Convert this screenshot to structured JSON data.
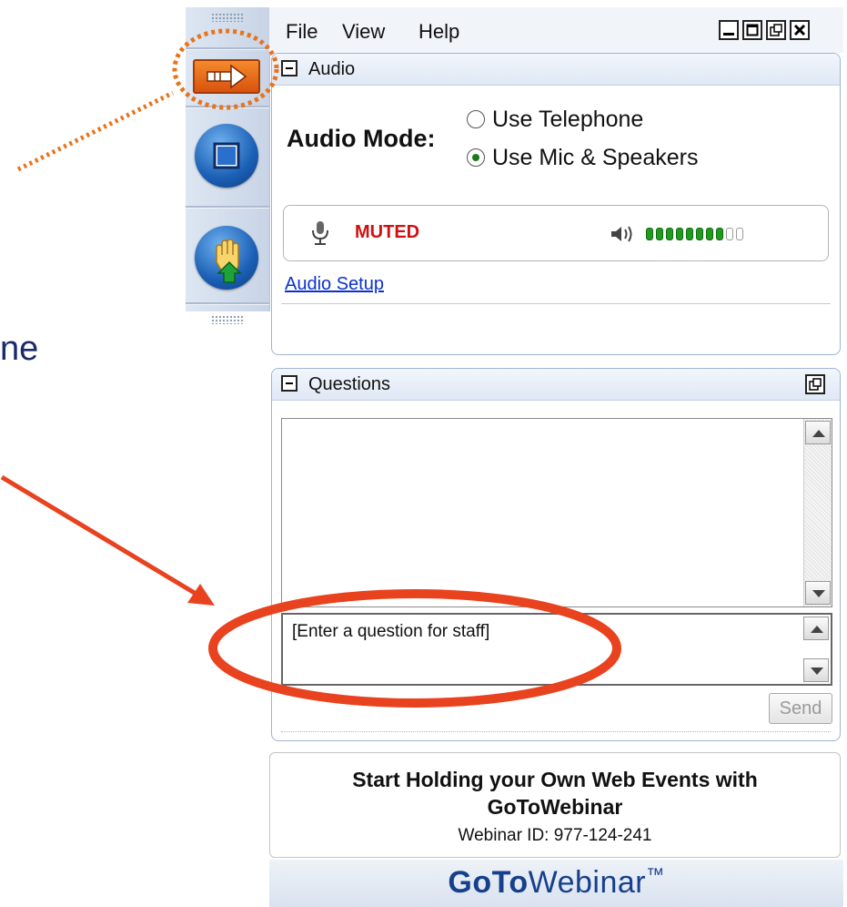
{
  "slide": {
    "text_fragment": "ne"
  },
  "menubar": {
    "file": "File",
    "view": "View",
    "help": "Help"
  },
  "audio": {
    "header": "Audio",
    "mode_label": "Audio Mode:",
    "options": [
      "Use Telephone",
      "Use Mic & Speakers"
    ],
    "selected_option": "Use Mic & Speakers",
    "mic_status": "MUTED",
    "speaker_level_fraction": 0.8,
    "setup_link": "Audio Setup"
  },
  "questions": {
    "header": "Questions",
    "input_placeholder": "[Enter a question for staff]",
    "send_label": "Send"
  },
  "promo": {
    "title_line1": "Start Holding your Own Web Events with",
    "title_line2": "GoToWebinar",
    "webinar_id": "Webinar ID: 977-124-241"
  },
  "brand": {
    "logo_part1": "GoTo",
    "logo_part2": "Webinar",
    "logo_tm": "™"
  },
  "colors": {
    "annotation_orange": "#e8731a",
    "annotation_red": "#e8421e",
    "muted_red": "#d01010",
    "level_green": "#1f9a1f"
  }
}
